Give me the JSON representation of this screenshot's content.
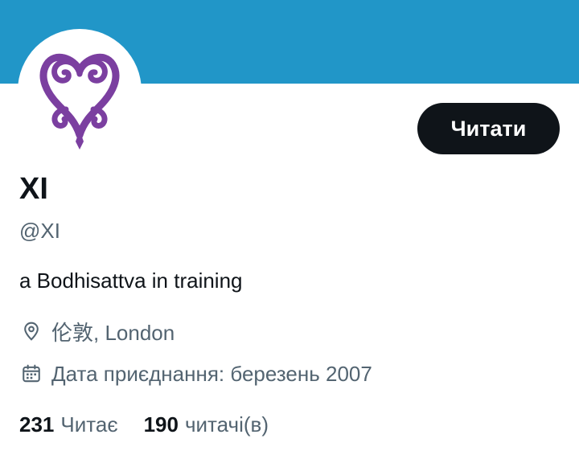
{
  "profile": {
    "display_name": "XI",
    "handle": "@XI",
    "bio": "a Bodhisattva in training",
    "location": "伦敦, London",
    "joined": "Дата приєднання: березень 2007",
    "follow_label": "Читати",
    "following_count": "231",
    "following_label": "Читає",
    "followers_count": "190",
    "followers_label": "читачі(в)"
  },
  "icons": {
    "location": "location-pin-icon",
    "joined": "calendar-icon",
    "avatar": "sankofa-symbol-icon"
  },
  "colors": {
    "banner": "#2196c8",
    "avatar_symbol": "#7b3fa0",
    "button_bg": "#0f1419",
    "button_text": "#ffffff",
    "secondary_text": "#536471",
    "primary_text": "#0f1419"
  }
}
